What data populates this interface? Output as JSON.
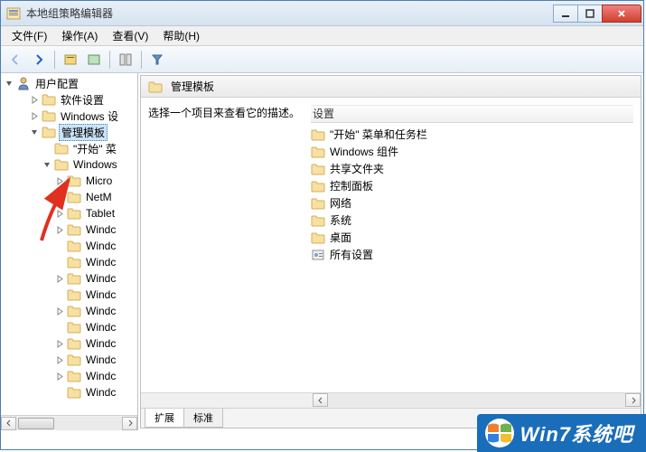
{
  "window": {
    "title": "本地组策略编辑器"
  },
  "menu": {
    "file": "文件(F)",
    "action": "操作(A)",
    "view": "查看(V)",
    "help": "帮助(H)"
  },
  "tree": {
    "root": "用户配置",
    "items": [
      {
        "label": "软件设置",
        "indent": 2,
        "expander": "closed"
      },
      {
        "label": "Windows 设",
        "indent": 2,
        "expander": "closed"
      },
      {
        "label": "管理模板",
        "indent": 2,
        "expander": "open",
        "selected": true
      },
      {
        "label": "\"开始\" 菜",
        "indent": 3,
        "expander": "none"
      },
      {
        "label": "Windows",
        "indent": 3,
        "expander": "open"
      },
      {
        "label": "Micro",
        "indent": 4,
        "expander": "closed"
      },
      {
        "label": "NetM",
        "indent": 4,
        "expander": "closed"
      },
      {
        "label": "Tablet",
        "indent": 4,
        "expander": "closed"
      },
      {
        "label": "Windc",
        "indent": 4,
        "expander": "closed"
      },
      {
        "label": "Windc",
        "indent": 4,
        "expander": "none"
      },
      {
        "label": "Windc",
        "indent": 4,
        "expander": "none"
      },
      {
        "label": "Windc",
        "indent": 4,
        "expander": "closed"
      },
      {
        "label": "Windc",
        "indent": 4,
        "expander": "none"
      },
      {
        "label": "Windc",
        "indent": 4,
        "expander": "closed"
      },
      {
        "label": "Windc",
        "indent": 4,
        "expander": "none"
      },
      {
        "label": "Windc",
        "indent": 4,
        "expander": "closed"
      },
      {
        "label": "Windc",
        "indent": 4,
        "expander": "closed"
      },
      {
        "label": "Windc",
        "indent": 4,
        "expander": "closed"
      },
      {
        "label": "Windc",
        "indent": 4,
        "expander": "none"
      }
    ]
  },
  "content": {
    "header": "管理模板",
    "description": "选择一个项目来查看它的描述。",
    "column_header": "设置",
    "items": [
      {
        "label": "\"开始\" 菜单和任务栏",
        "type": "folder"
      },
      {
        "label": "Windows 组件",
        "type": "folder"
      },
      {
        "label": "共享文件夹",
        "type": "folder"
      },
      {
        "label": "控制面板",
        "type": "folder"
      },
      {
        "label": "网络",
        "type": "folder"
      },
      {
        "label": "系统",
        "type": "folder"
      },
      {
        "label": "桌面",
        "type": "folder"
      },
      {
        "label": "所有设置",
        "type": "settings"
      }
    ]
  },
  "tabs": {
    "extended": "扩展",
    "standard": "标准"
  },
  "watermark": "Win7系统吧"
}
